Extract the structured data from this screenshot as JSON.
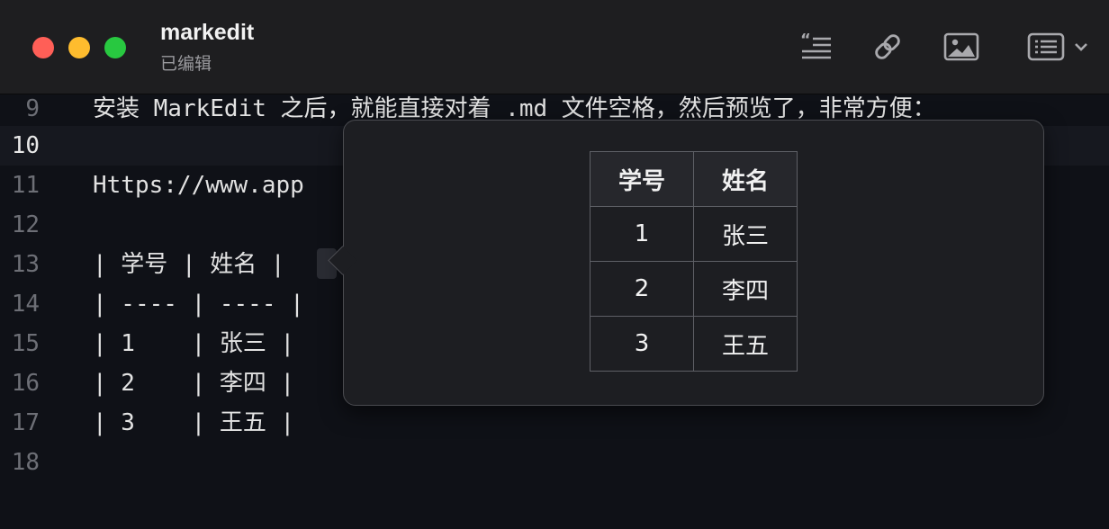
{
  "window": {
    "title": "markedit",
    "subtitle": "已编辑"
  },
  "toolbar": {
    "buttons": [
      {
        "icon": "quote-icon"
      },
      {
        "icon": "link-icon"
      },
      {
        "icon": "image-icon"
      },
      {
        "icon": "list-icon"
      }
    ]
  },
  "editor": {
    "lines": [
      {
        "num": "9",
        "text": "安装 MarkEdit 之后，就能直接对着 .md 文件空格，然后预览了，非常方便："
      },
      {
        "num": "10",
        "text": "",
        "current": true
      },
      {
        "num": "11",
        "text": "Https://www.app"
      },
      {
        "num": "12",
        "text": ""
      },
      {
        "num": "13",
        "text": "| 学号 | 姓名 |"
      },
      {
        "num": "14",
        "text": "| ---- | ---- |"
      },
      {
        "num": "15",
        "text": "| 1    | 张三 |"
      },
      {
        "num": "16",
        "text": "| 2    | 李四 |"
      },
      {
        "num": "17",
        "text": "| 3    | 王五 |"
      },
      {
        "num": "18",
        "text": ""
      }
    ]
  },
  "preview_table": {
    "headers": [
      "学号",
      "姓名"
    ],
    "rows": [
      [
        "1",
        "张三"
      ],
      [
        "2",
        "李四"
      ],
      [
        "3",
        "王五"
      ]
    ]
  },
  "colors": {
    "close": "#ff5f57",
    "minimize": "#febc2e",
    "zoom": "#28c840"
  }
}
